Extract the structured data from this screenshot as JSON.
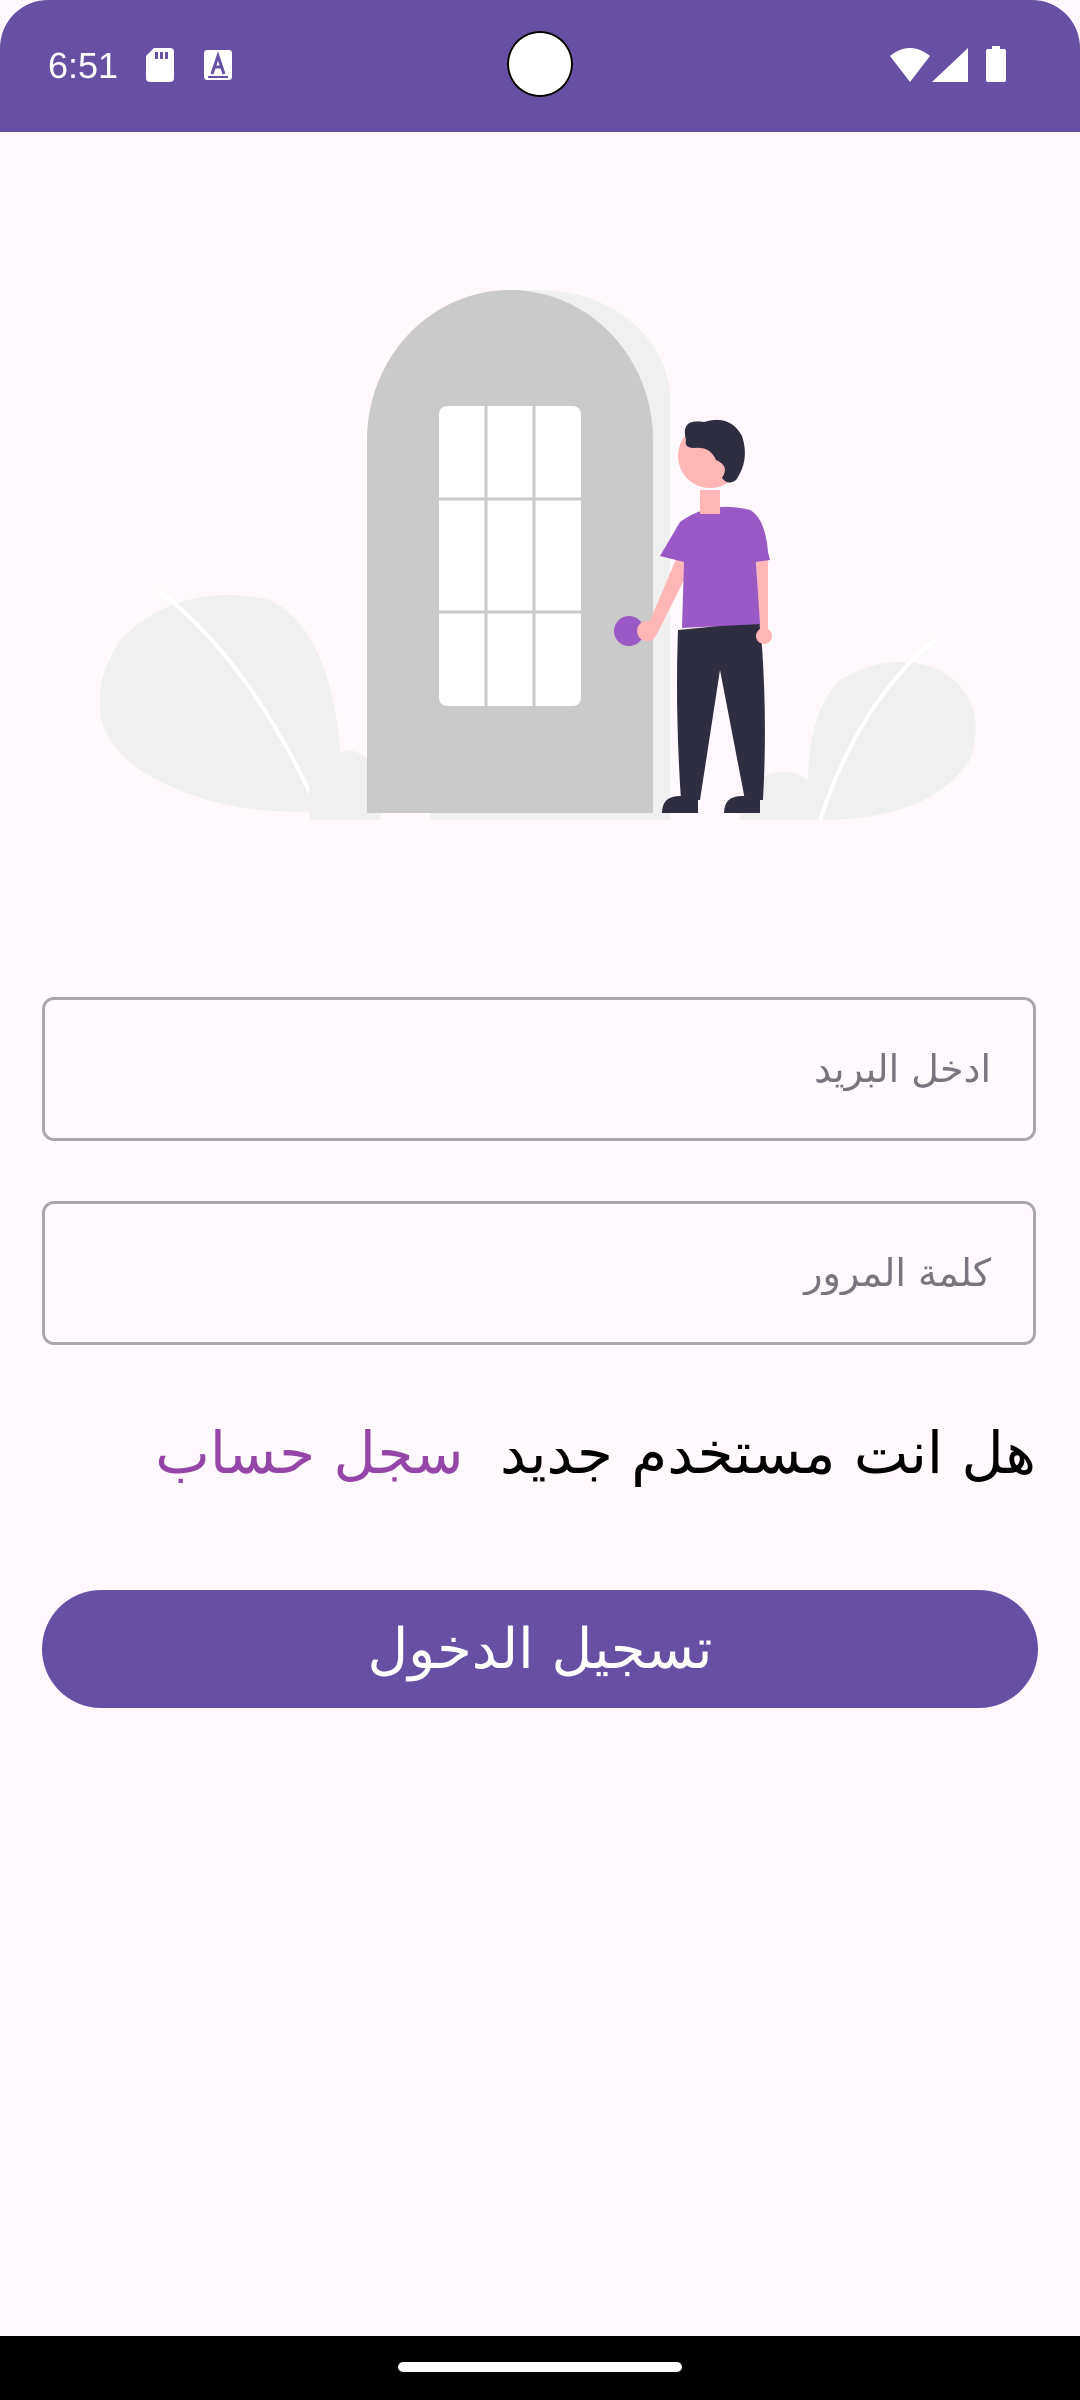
{
  "status_bar": {
    "time": "6:51",
    "background": "#6750A4",
    "icons": [
      "sd-card-icon",
      "text-a-icon",
      "wifi-icon",
      "cellular-signal-icon",
      "battery-icon"
    ]
  },
  "illustration": {
    "description_icon": "door-person-illustration",
    "accent": "#9B59C5"
  },
  "form": {
    "email": {
      "value": "",
      "placeholder": "ادخل البريد"
    },
    "password": {
      "value": "",
      "placeholder": "كلمة المرور"
    },
    "signup_question": "هل انت مستخدم جديد",
    "signup_link": "سجل حساب",
    "login_button": "تسجيل الدخول"
  },
  "colors": {
    "primary": "#6750A4",
    "link": "#9545A7",
    "background": "#FFF8FC",
    "field_border": "#A9A6AC"
  }
}
